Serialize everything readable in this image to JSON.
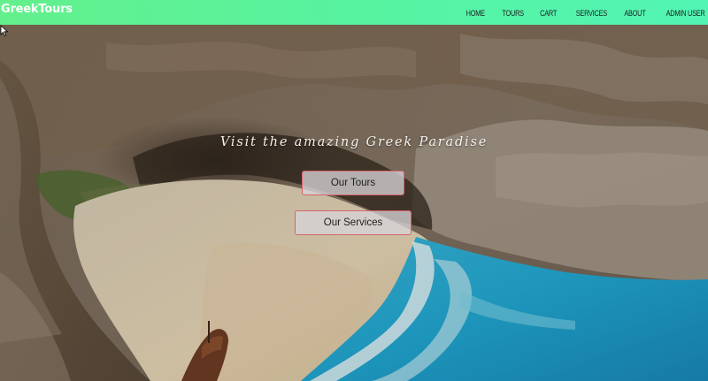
{
  "navbar": {
    "brand": "GreekTours",
    "links": [
      {
        "label": "Home"
      },
      {
        "label": "Tours"
      },
      {
        "label": "Cart"
      },
      {
        "label": "Services"
      },
      {
        "label": "About"
      },
      {
        "label": "Admin User"
      }
    ],
    "gradient_colors": [
      "#63f08c",
      "#52f5b4"
    ]
  },
  "hero": {
    "tagline": "Visit the amazing Greek Paradise",
    "buttons": {
      "tours": "Our Tours",
      "services": "Our Services"
    },
    "button_border_color": "#d8636b",
    "background": "beach-cove-photo"
  }
}
